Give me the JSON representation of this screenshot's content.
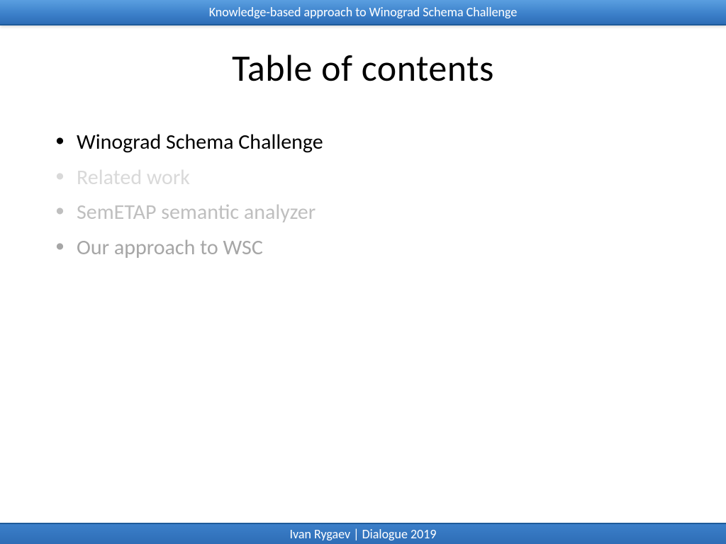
{
  "header": {
    "text": "Knowledge-based approach to Winograd  Schema Challenge"
  },
  "title": "Table of contents",
  "toc": [
    {
      "label": "Winograd Schema Challenge",
      "cls": "active"
    },
    {
      "label": "Related work",
      "cls": "dim1"
    },
    {
      "label": "SemETAP semantic analyzer",
      "cls": "dim2"
    },
    {
      "label": "Our approach to WSC",
      "cls": "dim3"
    }
  ],
  "footer": {
    "text": "Ivan Rygaev  |  Dialogue 2019"
  }
}
